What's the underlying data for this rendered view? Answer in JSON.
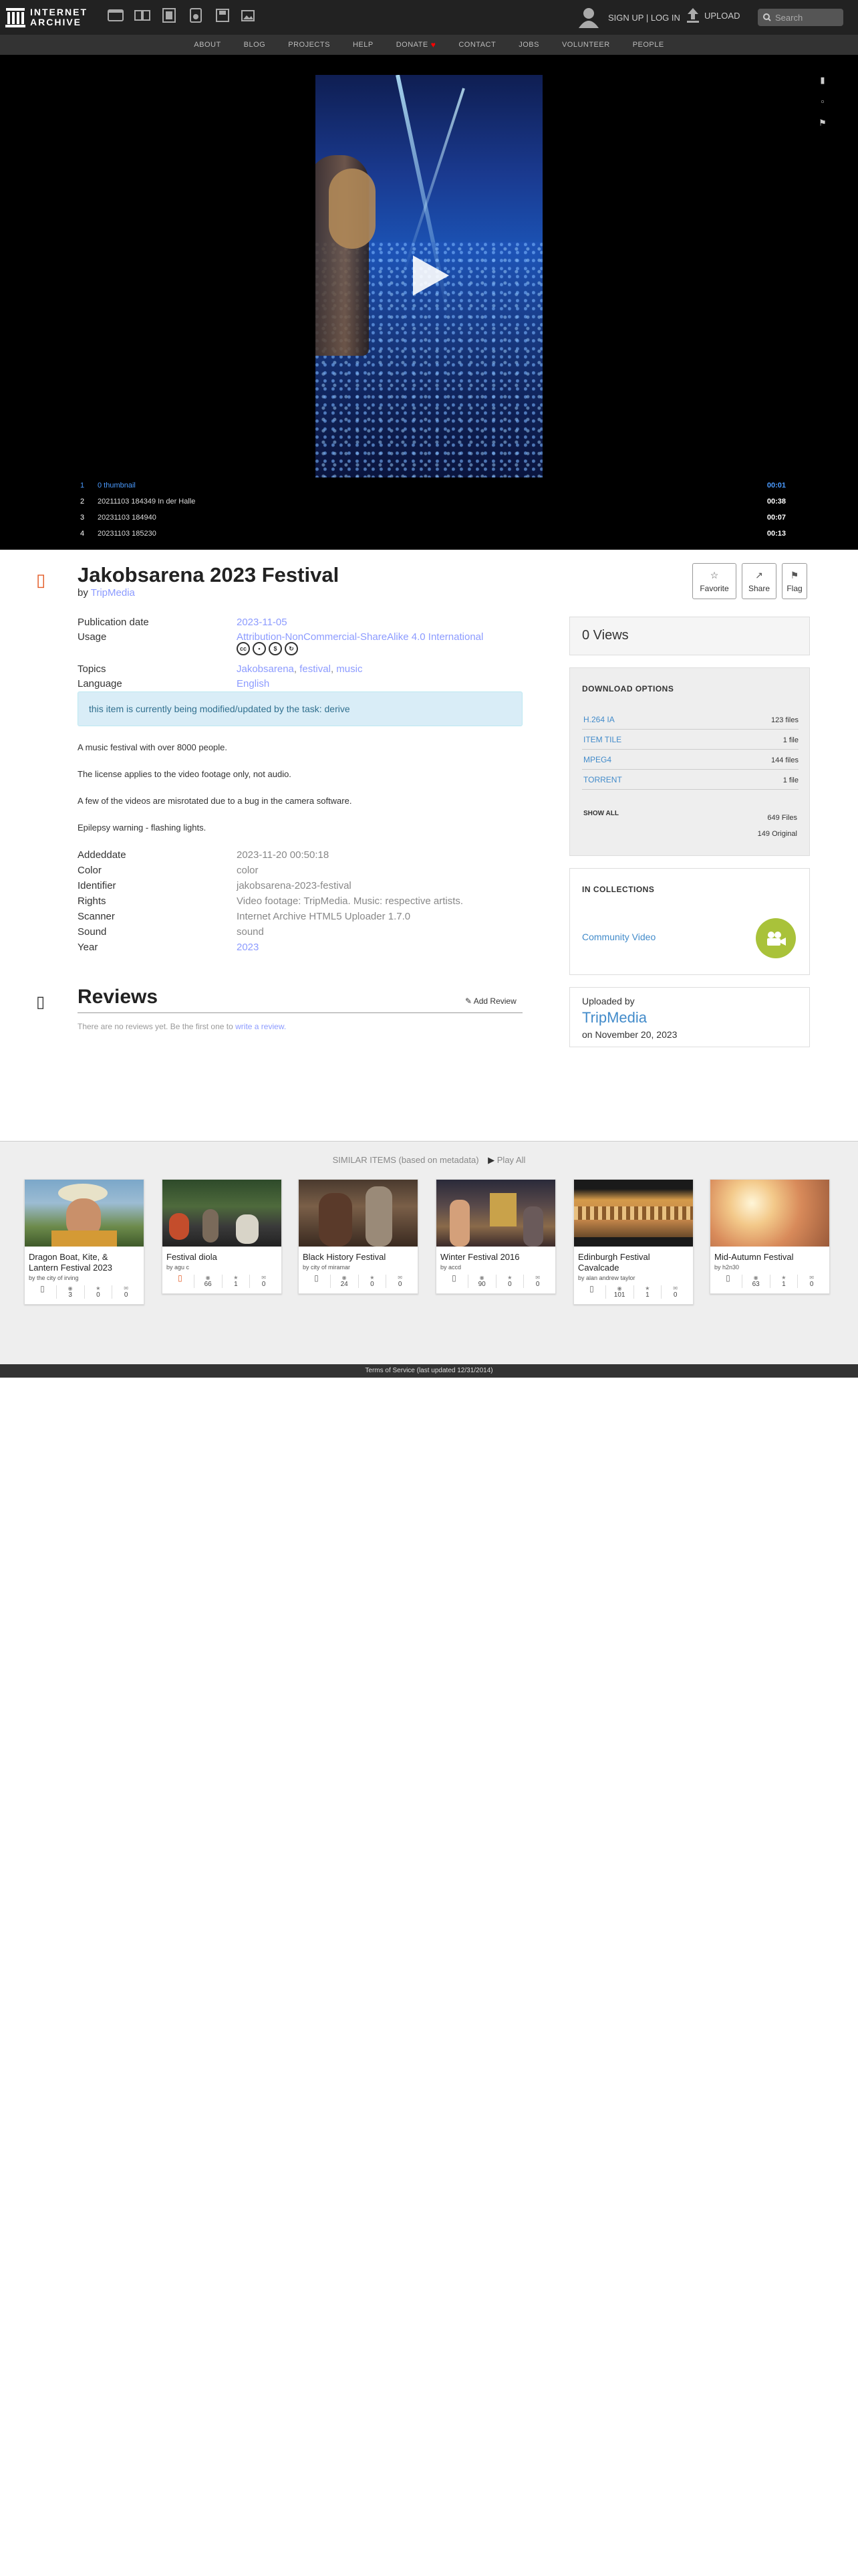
{
  "logo": {
    "line1": "INTERNET",
    "line2": "ARCHIVE"
  },
  "topnav": {
    "media_icons": [
      "web-icon",
      "texts-icon",
      "video-icon",
      "audio-icon",
      "software-icon",
      "images-icon"
    ],
    "signup_login": "SIGN UP | LOG IN",
    "upload": "UPLOAD",
    "search_placeholder": "Search"
  },
  "subnav": [
    "ABOUT",
    "BLOG",
    "PROJECTS",
    "HELP",
    "DONATE",
    "CONTACT",
    "JOBS",
    "VOLUNTEER",
    "PEOPLE"
  ],
  "playlist": [
    {
      "num": "1",
      "name": "0 thumbnail",
      "duration": "00:01"
    },
    {
      "num": "2",
      "name": "20211103 184349 In der Halle",
      "duration": "00:38"
    },
    {
      "num": "3",
      "name": "20231103 184940",
      "duration": "00:07"
    },
    {
      "num": "4",
      "name": "20231103 185230",
      "duration": "00:13"
    }
  ],
  "item": {
    "title": "Jakobsarena 2023 Festival",
    "by_label": "by",
    "creator": "TripMedia",
    "buttons": {
      "favorite": "Favorite",
      "share": "Share",
      "flag": "Flag"
    }
  },
  "metadata": {
    "publication_date_label": "Publication date",
    "publication_date": "2023-11-05",
    "usage_label": "Usage",
    "usage": "Attribution-NonCommercial-ShareAlike 4.0 International",
    "topics_label": "Topics",
    "topics": [
      "Jakobsarena",
      "festival",
      "music"
    ],
    "language_label": "Language",
    "language": "English"
  },
  "task_notice": "this item is currently being modified/updated by the task: derive",
  "description": [
    "A music festival with over 8000 people.",
    "The license applies to the video footage only, not audio.",
    "A few of the videos are misrotated due to a bug in the camera software.",
    "Epilepsy warning - flashing lights."
  ],
  "extra_metadata": [
    {
      "k": "Addeddate",
      "v": "2023-11-20 00:50:18"
    },
    {
      "k": "Color",
      "v": "color"
    },
    {
      "k": "Identifier",
      "v": "jakobsarena-2023-festival"
    },
    {
      "k": "Rights",
      "v": "Video footage: TripMedia. Music: respective artists."
    },
    {
      "k": "Scanner",
      "v": "Internet Archive HTML5 Uploader 1.7.0"
    },
    {
      "k": "Sound",
      "v": "sound"
    },
    {
      "k": "Year",
      "v": "2023"
    }
  ],
  "reviews": {
    "title": "Reviews",
    "add_review": "Add Review",
    "empty_text": "There are no reviews yet. Be the first one to",
    "write_link": "write a review."
  },
  "sidebar": {
    "views": "0 Views",
    "download_header": "DOWNLOAD OPTIONS",
    "downloads": [
      {
        "label": "H.264 IA",
        "count": "123 files"
      },
      {
        "label": "ITEM TILE",
        "count": "1 file"
      },
      {
        "label": "MPEG4",
        "count": "144 files"
      },
      {
        "label": "TORRENT",
        "count": "1 file"
      }
    ],
    "show_all": "SHOW ALL",
    "files_total": "649 Files",
    "original_total": "149 Original",
    "collections_header": "IN COLLECTIONS",
    "collection": "Community Video",
    "uploaded_by_label": "Uploaded by",
    "uploader": "TripMedia",
    "uploaded_on": "on November 20, 2023"
  },
  "similar": {
    "header": "SIMILAR ITEMS (based on metadata)",
    "play_all": "Play All",
    "items": [
      {
        "title": "Dragon Boat, Kite, & Lantern Festival 2023",
        "by": "by the city of irving",
        "views": "3",
        "favs": "0",
        "reviews": "0"
      },
      {
        "title": "Festival diola",
        "by": "by agu c",
        "views": "66",
        "favs": "1",
        "reviews": "0"
      },
      {
        "title": "Black History Festival",
        "by": "by city of miramar",
        "views": "24",
        "favs": "0",
        "reviews": "0"
      },
      {
        "title": "Winter Festival 2016",
        "by": "by accd",
        "views": "90",
        "favs": "0",
        "reviews": "0"
      },
      {
        "title": "Edinburgh Festival Cavalcade",
        "by": "by alan andrew taylor",
        "views": "101",
        "favs": "1",
        "reviews": "0"
      },
      {
        "title": "Mid-Autumn Festival",
        "by": "by h2n30",
        "views": "63",
        "favs": "1",
        "reviews": "0"
      }
    ]
  },
  "footer": "Terms of Service (last updated 12/31/2014)",
  "colors": {
    "accent": "#428bca",
    "donate_heart": "#ff0100",
    "collection_badge": "#a9c23a",
    "item_icon": "#e35b26"
  }
}
